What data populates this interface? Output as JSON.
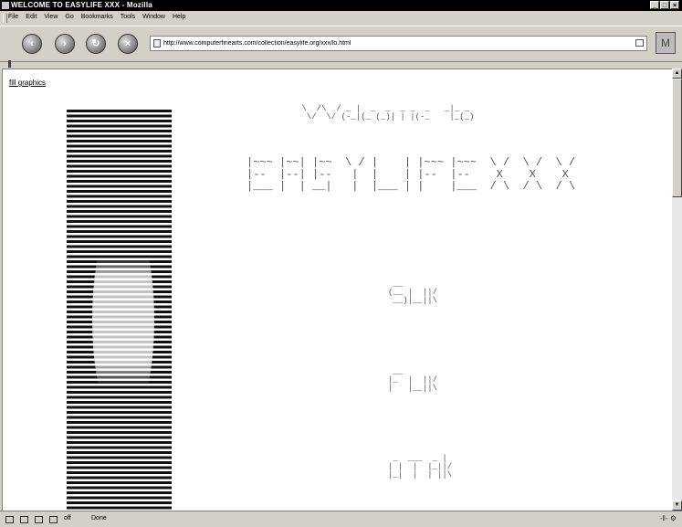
{
  "window": {
    "title": "WELCOME TO EASYLIFE XXX - Mozilla",
    "minimize": "_",
    "maximize": "□",
    "close": "×"
  },
  "menu": [
    "File",
    "Edit",
    "View",
    "Go",
    "Bookmarks",
    "Tools",
    "Window",
    "Help"
  ],
  "nav": {
    "back": "‹",
    "forward": "›",
    "reload": "↻",
    "stop": "×",
    "url": "http://www.computerfinearts.com/collection/easylife.org/xxx/lo.html",
    "brand": "M"
  },
  "page": {
    "link": "fill graphics",
    "art_welcome": " \\  /\\  / _ |  _  _  _ _  _   _|_ _ \n  \\/  \\/ (-_|(_ (_)| | |(-_    |_(_)",
    "art_easylife": "|~~~ |~~| |~~  \\ / |    | |~~~ |~~~  \\ /  \\ /  \\ /\n|--  |--| |--   |  |    | |--  |--    X    X    X \n|___ |  | __|   |  |___ | |    |___  / \\  / \\  / \\",
    "art_suck": " __        \n(__ |  ||/ \n __)|__||\\ ",
    "art_fuck": " __        \n|_  |  ||/ \n|   |__||\\ ",
    "art_otak": " _  ___  _ |  \n| |  |  |_||/ \n|_|  |  | ||\\ "
  },
  "status": {
    "text": "Done",
    "online": "off",
    "right": "-‖- ⚙"
  }
}
